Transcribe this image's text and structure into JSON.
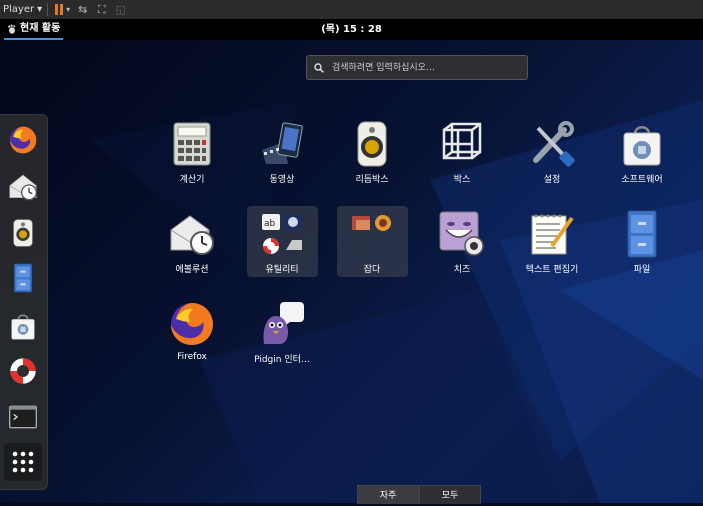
{
  "player": {
    "menu_label": "Player"
  },
  "topbar": {
    "activities_label": "현재 활동",
    "clock": "(목) 15 : 28"
  },
  "search": {
    "placeholder": "검색하려면 입력하십시오…"
  },
  "dash": {
    "items": [
      {
        "name": "firefox",
        "icon": "firefox-icon"
      },
      {
        "name": "evolution",
        "icon": "evolution-icon"
      },
      {
        "name": "rhythmbox",
        "icon": "rhythmbox-icon"
      },
      {
        "name": "files",
        "icon": "file-cabinet-icon"
      },
      {
        "name": "software",
        "icon": "software-bag-icon"
      },
      {
        "name": "help",
        "icon": "lifebuoy-icon"
      },
      {
        "name": "terminal",
        "icon": "terminal-icon"
      }
    ],
    "show_apps_icon": "grid-icon"
  },
  "apps": [
    {
      "label": "계산기",
      "icon": "calculator-icon"
    },
    {
      "label": "동영상",
      "icon": "video-icon"
    },
    {
      "label": "리듬박스",
      "icon": "rhythmbox-icon"
    },
    {
      "label": "박스",
      "icon": "boxes-icon"
    },
    {
      "label": "설정",
      "icon": "settings-tools-icon"
    },
    {
      "label": "소프트웨어",
      "icon": "software-bag-icon"
    },
    {
      "label": "에볼루션",
      "icon": "evolution-icon"
    },
    {
      "label": "유틸리티",
      "icon": "utilities-folder-icon"
    },
    {
      "label": "잡다",
      "icon": "sundry-folder-icon"
    },
    {
      "label": "치즈",
      "icon": "cheese-icon"
    },
    {
      "label": "텍스트 편집기",
      "icon": "text-editor-icon"
    },
    {
      "label": "파일",
      "icon": "file-cabinet-icon"
    },
    {
      "label": "Firefox",
      "icon": "firefox-icon"
    },
    {
      "label": "Pidgin 인터…",
      "icon": "pidgin-icon"
    }
  ],
  "view_tabs": [
    {
      "label": "자주",
      "active": true
    },
    {
      "label": "모두",
      "active": false
    }
  ]
}
